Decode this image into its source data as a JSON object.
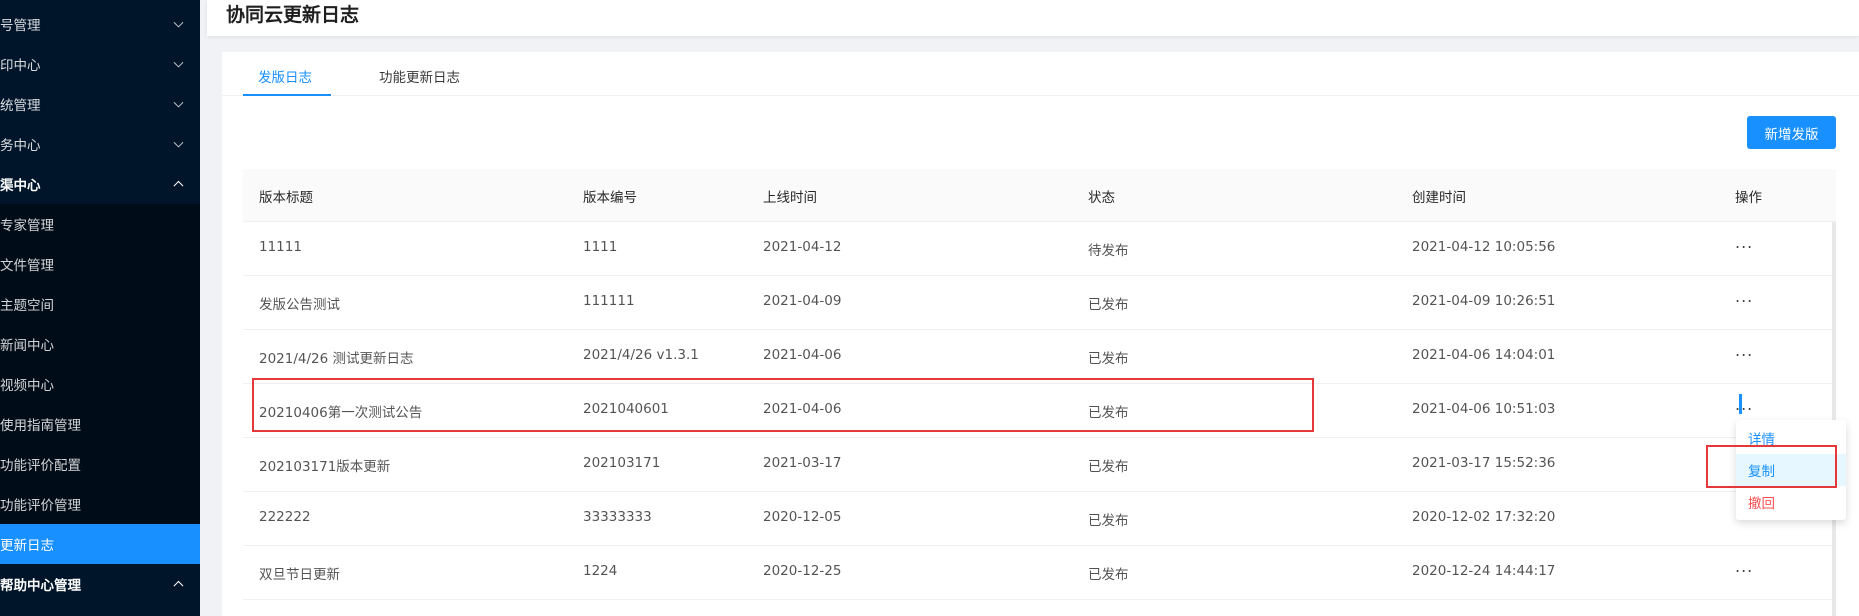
{
  "sidebar": {
    "items": [
      {
        "label": "号管理"
      },
      {
        "label": "印中心"
      },
      {
        "label": "统管理"
      },
      {
        "label": "务中心"
      },
      {
        "label": "渠中心"
      }
    ],
    "sub_items": [
      {
        "label": "专家管理"
      },
      {
        "label": "文件管理"
      },
      {
        "label": "主题空间"
      },
      {
        "label": "新闻中心"
      },
      {
        "label": "视频中心"
      },
      {
        "label": "使用指南管理"
      },
      {
        "label": "功能评价配置"
      },
      {
        "label": "功能评价管理"
      },
      {
        "label": "更新日志"
      }
    ],
    "bottom_group": {
      "label": "帮助中心管理"
    }
  },
  "header": {
    "title": "协同云更新日志"
  },
  "tabs": [
    {
      "label": "发版日志"
    },
    {
      "label": "功能更新日志"
    }
  ],
  "toolbar": {
    "add_label": "新增发版"
  },
  "table": {
    "columns": [
      "版本标题",
      "版本编号",
      "上线时间",
      "状态",
      "创建时间",
      "操作"
    ],
    "action_label": "...",
    "rows": [
      {
        "title": "11111",
        "code": "1111",
        "online": "2021-04-12",
        "status": "待发布",
        "created": "2021-04-12 10:05:56"
      },
      {
        "title": "发版公告测试",
        "code": "111111",
        "online": "2021-04-09",
        "status": "已发布",
        "created": "2021-04-09 10:26:51"
      },
      {
        "title": "2021/4/26 测试更新日志",
        "code": "2021/4/26 v1.3.1",
        "online": "2021-04-06",
        "status": "已发布",
        "created": "2021-04-06 14:04:01"
      },
      {
        "title": "20210406第一次测试公告",
        "code": "2021040601",
        "online": "2021-04-06",
        "status": "已发布",
        "created": "2021-04-06 10:51:03"
      },
      {
        "title": "202103171版本更新",
        "code": "202103171",
        "online": "2021-03-17",
        "status": "已发布",
        "created": "2021-03-17 15:52:36"
      },
      {
        "title": "222222",
        "code": "33333333",
        "online": "2020-12-05",
        "status": "已发布",
        "created": "2020-12-02 17:32:20"
      },
      {
        "title": "双旦节日更新",
        "code": "1224",
        "online": "2020-12-25",
        "status": "已发布",
        "created": "2020-12-24 14:44:17"
      }
    ]
  },
  "dropdown": {
    "items": [
      {
        "label": "详情"
      },
      {
        "label": "复制"
      },
      {
        "label": "撤回"
      }
    ]
  },
  "colors": {
    "sidebar_bg": "#001529",
    "sidebar_active": "#1890ff",
    "primary": "#1890ff",
    "danger": "#ff4d4f",
    "highlight_box": "#e5383b"
  }
}
